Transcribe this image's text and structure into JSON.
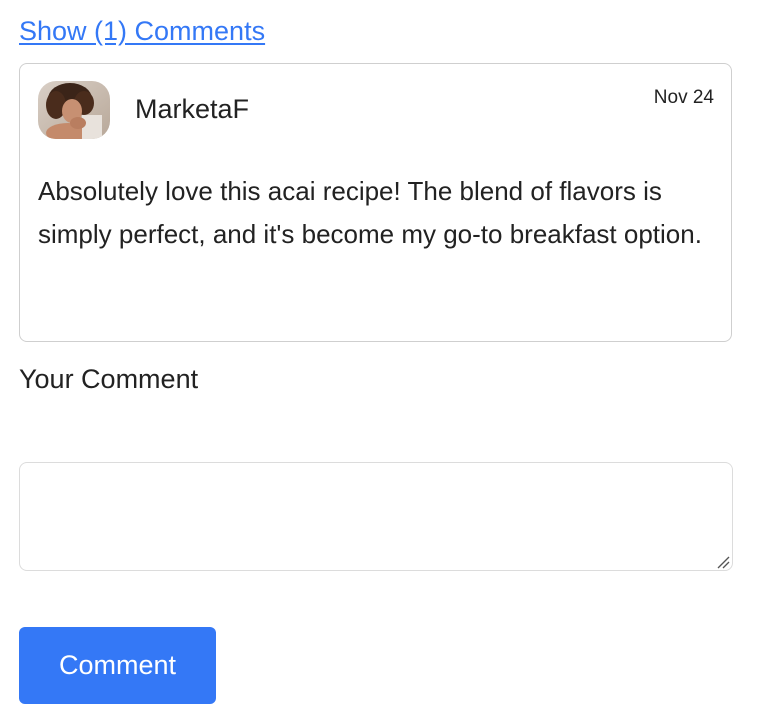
{
  "comments_toggle": {
    "label": "Show (1) Comments"
  },
  "comments": [
    {
      "author": "MarketaF",
      "date": "Nov 24",
      "text": "Absolutely love this acai recipe! The blend of flavors is simply perfect, and it's become my go-to breakfast option."
    }
  ],
  "form": {
    "label": "Your Comment",
    "value": "",
    "placeholder": "",
    "submit_label": "Comment"
  },
  "colors": {
    "accent": "#3478f6",
    "text": "#222222",
    "border": "#cfcfcf"
  }
}
